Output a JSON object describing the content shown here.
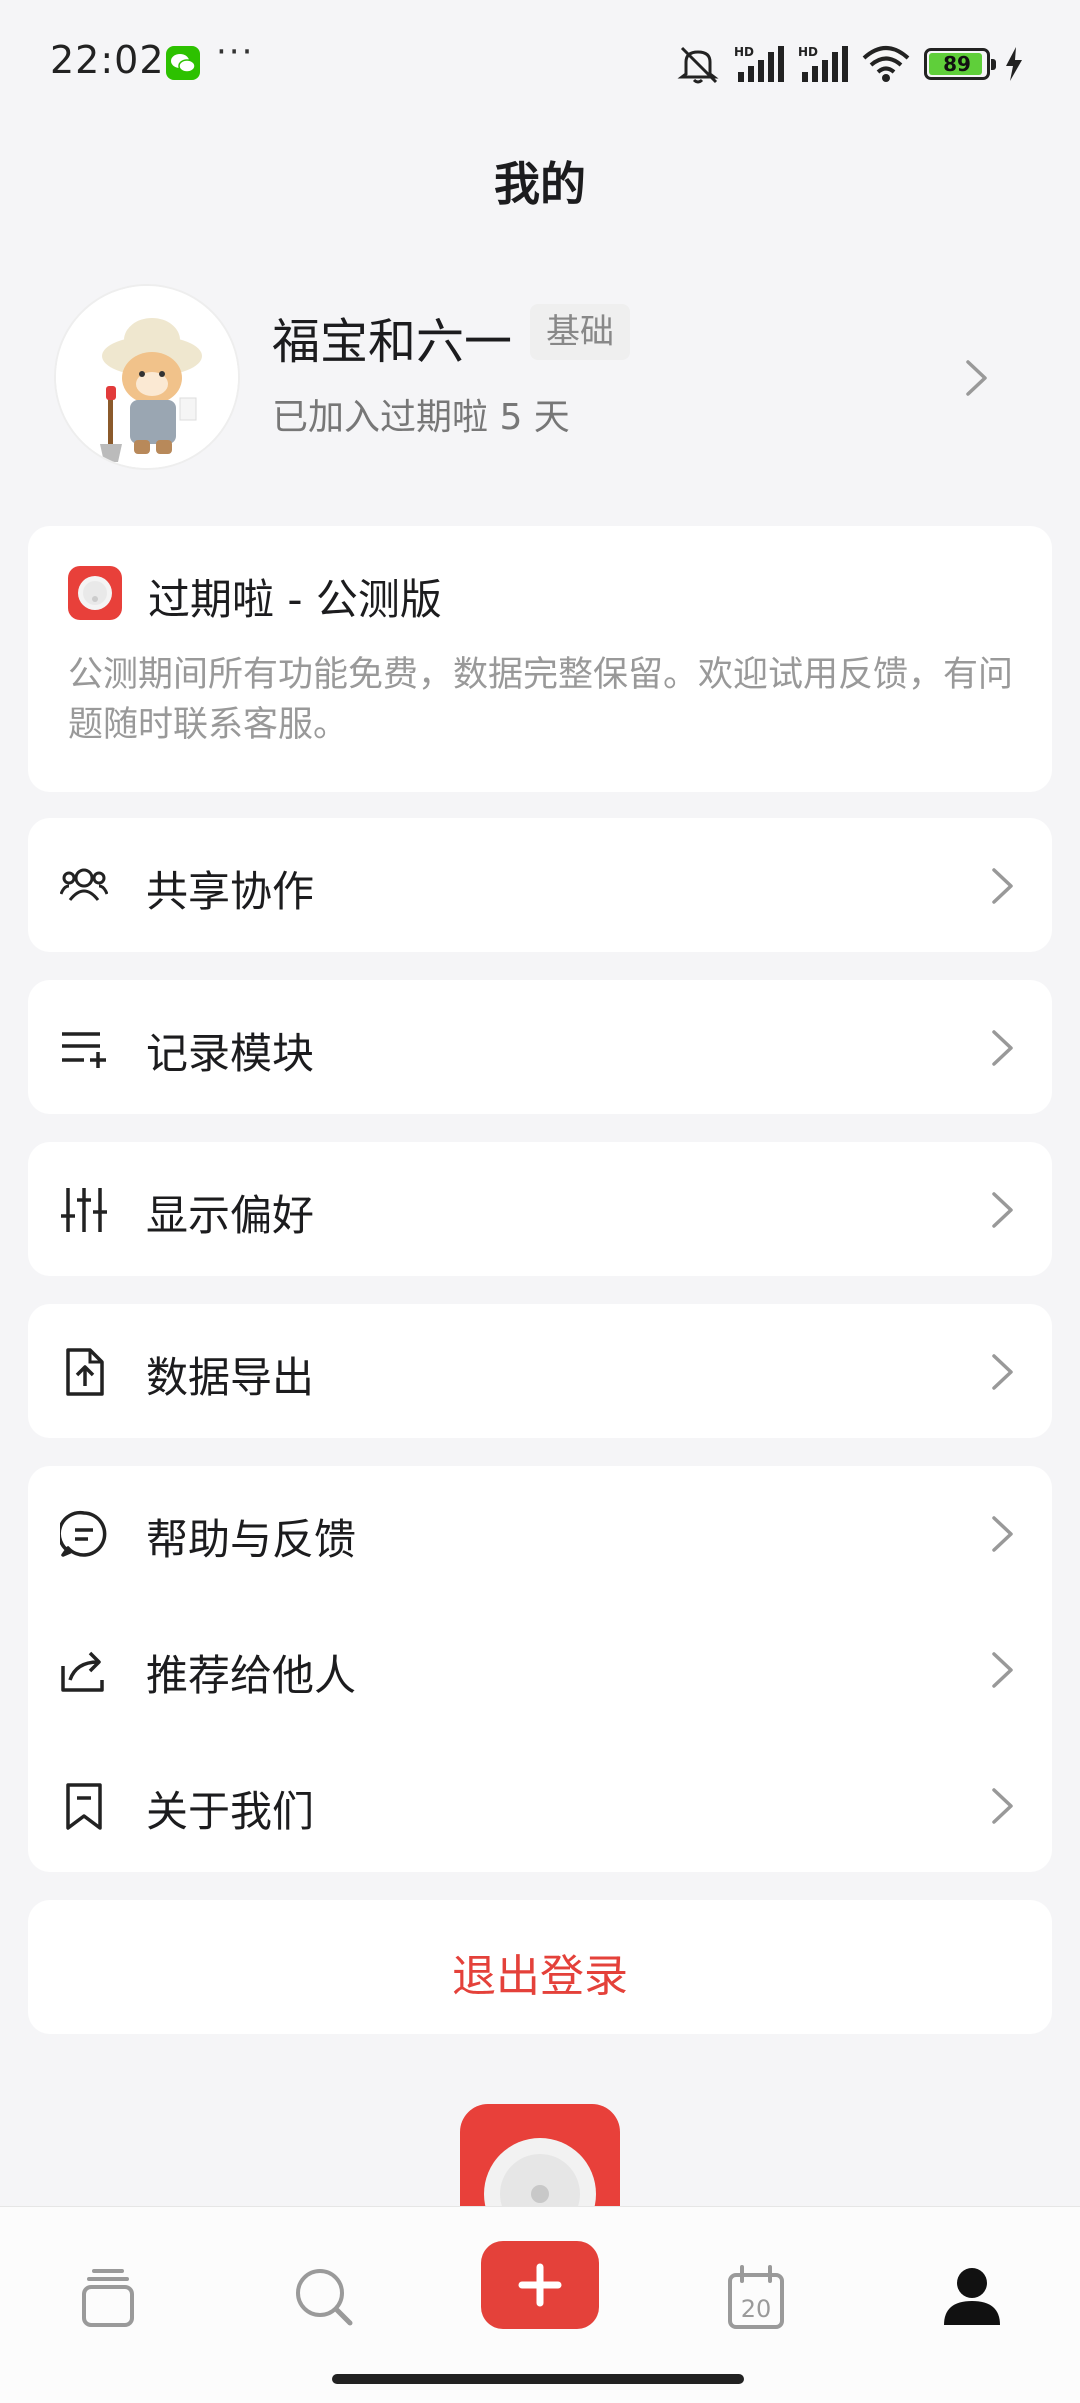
{
  "status_bar": {
    "time": "22:02",
    "dots": "···",
    "battery": "89",
    "battery_level": 0.89,
    "icons": [
      "wechat-icon",
      "mute-icon",
      "hd-signal-icon",
      "hd-signal-icon",
      "wifi-icon",
      "battery-icon",
      "charging-icon"
    ]
  },
  "header": {
    "title": "我的"
  },
  "profile": {
    "name": "福宝和六一",
    "plan": "基础",
    "joined": "已加入过期啦 5 天"
  },
  "notice": {
    "title": "过期啦 - 公测版",
    "description": "公测期间所有功能免费，数据完整保留。欢迎试用反馈，有问题随时联系客服。"
  },
  "menu": {
    "share": "共享协作",
    "modules": "记录模块",
    "display": "显示偏好",
    "export": "数据导出",
    "help": "帮助与反馈",
    "recommend": "推荐给他人",
    "about": "关于我们"
  },
  "logout": {
    "label": "退出登录"
  },
  "nav": {
    "items": [
      "stack-icon",
      "search-icon",
      "add-icon",
      "calendar-icon",
      "profile-icon"
    ],
    "calendar_day": "20"
  },
  "colors": {
    "accent": "#e4413a",
    "background": "#f5f5f7",
    "card": "#ffffff",
    "secondary_text": "#999999"
  }
}
